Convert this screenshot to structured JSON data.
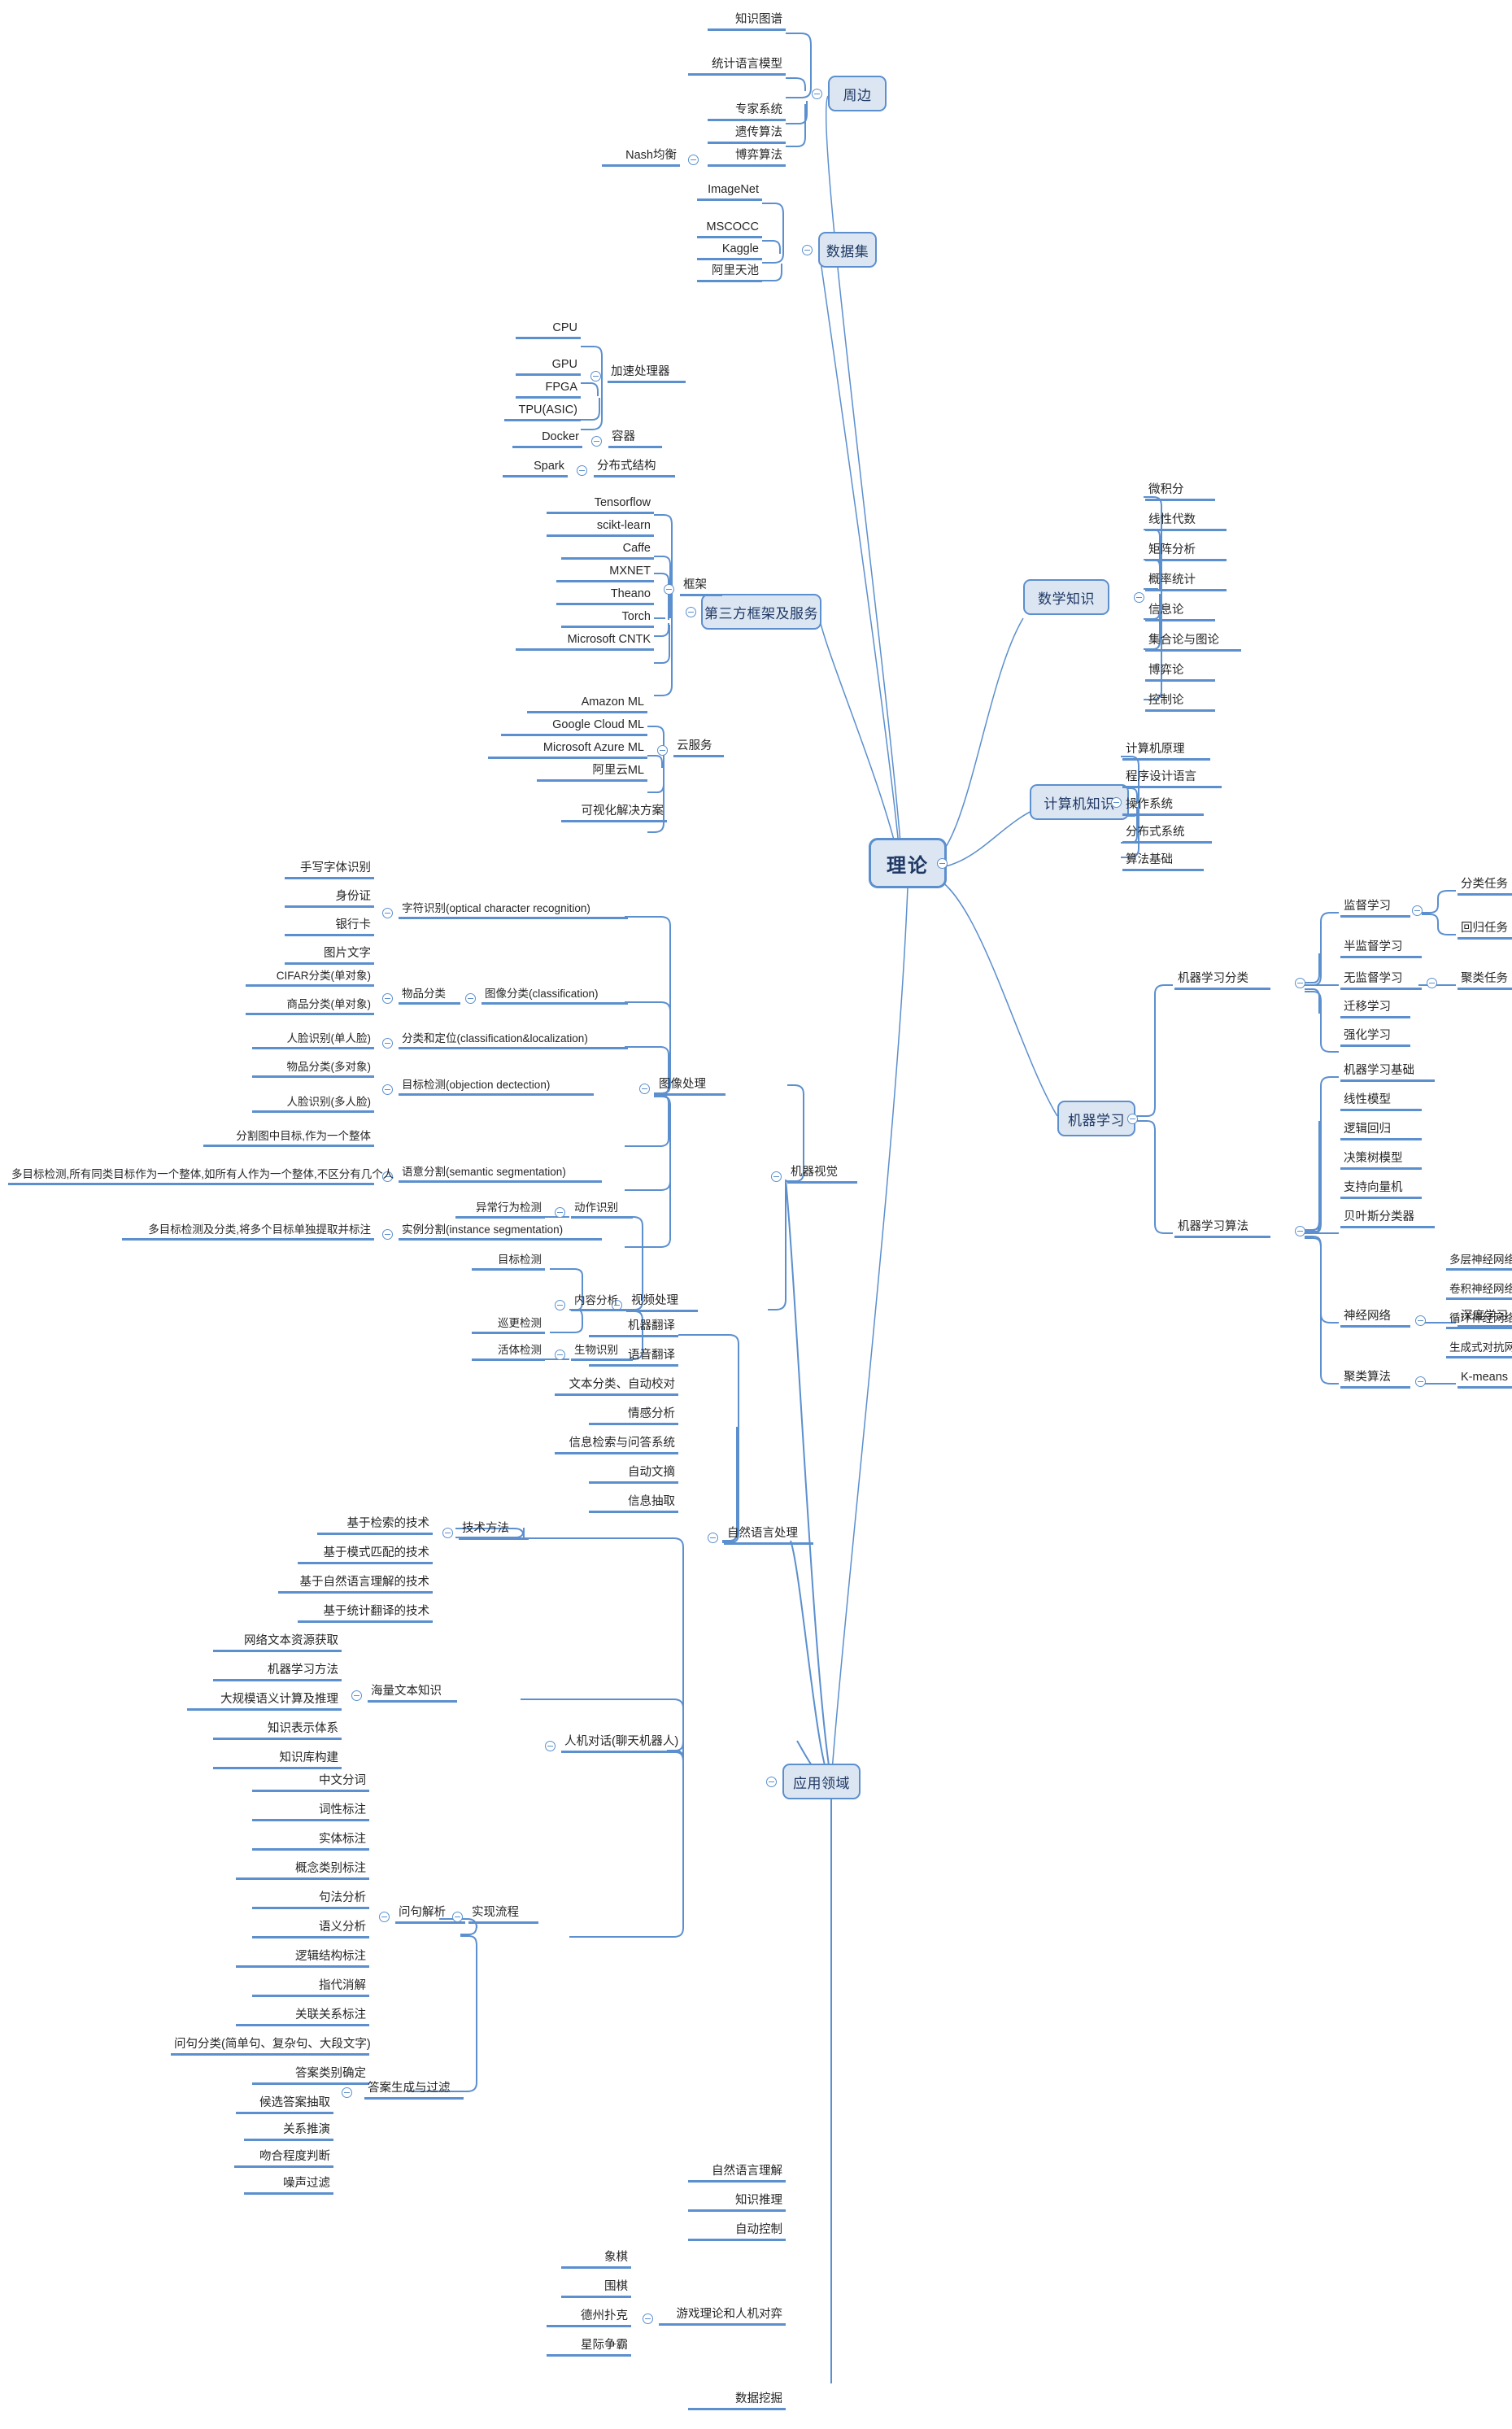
{
  "title": "理论",
  "colors": {
    "node_fill": "#dce6f2",
    "node_border": "#5b8fce",
    "underline": "#5b8fce",
    "text": "#262626",
    "box_text": "#1f3864",
    "background": "#ffffff"
  },
  "root": {
    "label": "理论"
  },
  "branches": {
    "zhoubian": {
      "label": "周边",
      "children": [
        {
          "label": "知识图谱"
        },
        {
          "label": "统计语言模型"
        },
        {
          "label": "专家系统"
        },
        {
          "label": "遗传算法"
        },
        {
          "label": "博弈算法",
          "children": [
            {
              "label": "Nash均衡"
            }
          ]
        }
      ]
    },
    "shujuji": {
      "label": "数据集",
      "children": [
        {
          "label": "ImageNet"
        },
        {
          "label": "MSCOCC"
        },
        {
          "label": "Kaggle"
        },
        {
          "label": "阿里天池"
        }
      ]
    },
    "disanfang": {
      "label": "第三方框架及服务",
      "children": [
        {
          "label": "加速处理器",
          "children": [
            {
              "label": "CPU"
            },
            {
              "label": "GPU"
            },
            {
              "label": "FPGA"
            },
            {
              "label": "TPU(ASIC)"
            }
          ]
        },
        {
          "label": "容器",
          "children": [
            {
              "label": "Docker"
            }
          ]
        },
        {
          "label": "分布式结构",
          "children": [
            {
              "label": "Spark"
            }
          ]
        },
        {
          "label": "框架",
          "children": [
            {
              "label": "Tensorflow"
            },
            {
              "label": "scikt-learn"
            },
            {
              "label": "Caffe"
            },
            {
              "label": "MXNET"
            },
            {
              "label": "Theano"
            },
            {
              "label": "Torch"
            },
            {
              "label": "Microsoft CNTK"
            }
          ]
        },
        {
          "label": "云服务",
          "children": [
            {
              "label": "Amazon ML"
            },
            {
              "label": "Google Cloud ML"
            },
            {
              "label": "Microsoft Azure ML"
            },
            {
              "label": "阿里云ML"
            }
          ]
        },
        {
          "label": "可视化解决方案"
        }
      ]
    },
    "shuxue": {
      "label": "数学知识",
      "children": [
        {
          "label": "微积分"
        },
        {
          "label": "线性代数"
        },
        {
          "label": "矩阵分析"
        },
        {
          "label": "概率统计"
        },
        {
          "label": "信息论"
        },
        {
          "label": "集合论与图论"
        },
        {
          "label": "博弈论"
        },
        {
          "label": "控制论"
        }
      ]
    },
    "jisuanji": {
      "label": "计算机知识",
      "children": [
        {
          "label": "计算机原理"
        },
        {
          "label": "程序设计语言"
        },
        {
          "label": "操作系统"
        },
        {
          "label": "分布式系统"
        },
        {
          "label": "算法基础"
        }
      ]
    },
    "jiqixuexi": {
      "label": "机器学习",
      "children": [
        {
          "label": "机器学习分类",
          "children": [
            {
              "label": "监督学习",
              "children": [
                {
                  "label": "分类任务"
                },
                {
                  "label": "回归任务"
                }
              ]
            },
            {
              "label": "半监督学习"
            },
            {
              "label": "无监督学习",
              "children": [
                {
                  "label": "聚类任务"
                }
              ]
            },
            {
              "label": "迁移学习"
            },
            {
              "label": "强化学习"
            }
          ]
        },
        {
          "label": "机器学习算法",
          "children": [
            {
              "label": "机器学习基础"
            },
            {
              "label": "线性模型"
            },
            {
              "label": "逻辑回归"
            },
            {
              "label": "决策树模型"
            },
            {
              "label": "支持向量机"
            },
            {
              "label": "贝叶斯分类器"
            },
            {
              "label": "神经网络",
              "children": [
                {
                  "label": "深度学习",
                  "children": [
                    {
                      "label": "多层神经网络(MLP)"
                    },
                    {
                      "label": "卷积神经网络(CNN)"
                    },
                    {
                      "label": "循环神经网络(RNN)"
                    },
                    {
                      "label": "生成式对抗网络(GAN)"
                    }
                  ]
                }
              ]
            },
            {
              "label": "聚类算法",
              "children": [
                {
                  "label": "K-means"
                }
              ]
            }
          ]
        }
      ]
    },
    "yingyong": {
      "label": "应用领域",
      "children": [
        {
          "label": "机器视觉",
          "children": [
            {
              "label": "图像处理",
              "children": [
                {
                  "label": "字符识别(optical character recognition)",
                  "children": [
                    {
                      "label": "手写字体识别"
                    },
                    {
                      "label": "身份证"
                    },
                    {
                      "label": "银行卡"
                    },
                    {
                      "label": "图片文字"
                    }
                  ]
                },
                {
                  "label": "图像分类(classification)",
                  "children": [
                    {
                      "label": "物品分类",
                      "children": [
                        {
                          "label": "CIFAR分类(单对象)"
                        },
                        {
                          "label": "商品分类(单对象)"
                        }
                      ]
                    }
                  ]
                },
                {
                  "label": "分类和定位(classification&localization)",
                  "children": [
                    {
                      "label": "人脸识别(单人脸)"
                    }
                  ]
                },
                {
                  "label": "目标检测(objection dectection)",
                  "children": [
                    {
                      "label": "物品分类(多对象)"
                    },
                    {
                      "label": "人脸识别(多人脸)"
                    }
                  ]
                },
                {
                  "label": "语意分割(semantic segmentation)",
                  "children": [
                    {
                      "label": "分割图中目标,作为一个整体"
                    },
                    {
                      "label": "多目标检测,所有同类目标作为一个整体,如所有人作为一个整体,不区分有几个人"
                    }
                  ]
                },
                {
                  "label": "实例分割(instance segmentation)",
                  "children": [
                    {
                      "label": "多目标检测及分类,将多个目标单独提取并标注"
                    }
                  ]
                }
              ]
            },
            {
              "label": "视频处理",
              "children": [
                {
                  "label": "动作识别",
                  "children": [
                    {
                      "label": "异常行为检测"
                    }
                  ]
                },
                {
                  "label": "内容分析",
                  "children": [
                    {
                      "label": "目标检测"
                    },
                    {
                      "label": "巡更检测"
                    }
                  ]
                },
                {
                  "label": "生物识别",
                  "children": [
                    {
                      "label": "活体检测"
                    }
                  ]
                }
              ]
            }
          ]
        },
        {
          "label": "自然语言处理",
          "children": [
            {
              "label": "机器翻译"
            },
            {
              "label": "语音翻译"
            },
            {
              "label": "文本分类、自动校对"
            },
            {
              "label": "情感分析"
            },
            {
              "label": "信息检索与问答系统"
            },
            {
              "label": "自动文摘"
            },
            {
              "label": "信息抽取"
            }
          ]
        },
        {
          "label": "人机对话(聊天机器人)",
          "children": [
            {
              "label": "技术方法",
              "children": [
                {
                  "label": "基于检索的技术"
                },
                {
                  "label": "基于模式匹配的技术"
                },
                {
                  "label": "基于自然语言理解的技术"
                },
                {
                  "label": "基于统计翻译的技术"
                }
              ]
            },
            {
              "label": "海量文本知识",
              "children": [
                {
                  "label": "网络文本资源获取"
                },
                {
                  "label": "机器学习方法"
                },
                {
                  "label": "大规模语义计算及推理"
                },
                {
                  "label": "知识表示体系"
                },
                {
                  "label": "知识库构建"
                }
              ]
            },
            {
              "label": "实现流程",
              "children": [
                {
                  "label": "问句解析",
                  "children": [
                    {
                      "label": "中文分词"
                    },
                    {
                      "label": "词性标注"
                    },
                    {
                      "label": "实体标注"
                    },
                    {
                      "label": "概念类别标注"
                    },
                    {
                      "label": "句法分析"
                    },
                    {
                      "label": "语义分析"
                    },
                    {
                      "label": "逻辑结构标注"
                    },
                    {
                      "label": "指代消解"
                    },
                    {
                      "label": "关联关系标注"
                    },
                    {
                      "label": "问句分类(简单句、复杂句、大段文字)"
                    },
                    {
                      "label": "答案类别确定"
                    }
                  ]
                },
                {
                  "label": "答案生成与过滤",
                  "children": [
                    {
                      "label": "候选答案抽取"
                    },
                    {
                      "label": "关系推演"
                    },
                    {
                      "label": "吻合程度判断"
                    },
                    {
                      "label": "噪声过滤"
                    }
                  ]
                }
              ]
            }
          ]
        },
        {
          "label": "自然语言理解"
        },
        {
          "label": "知识推理"
        },
        {
          "label": "自动控制"
        },
        {
          "label": "游戏理论和人机对弈",
          "children": [
            {
              "label": "象棋"
            },
            {
              "label": "围棋"
            },
            {
              "label": "德州扑克"
            },
            {
              "label": "星际争霸"
            }
          ]
        },
        {
          "label": "数据挖掘"
        }
      ]
    }
  }
}
